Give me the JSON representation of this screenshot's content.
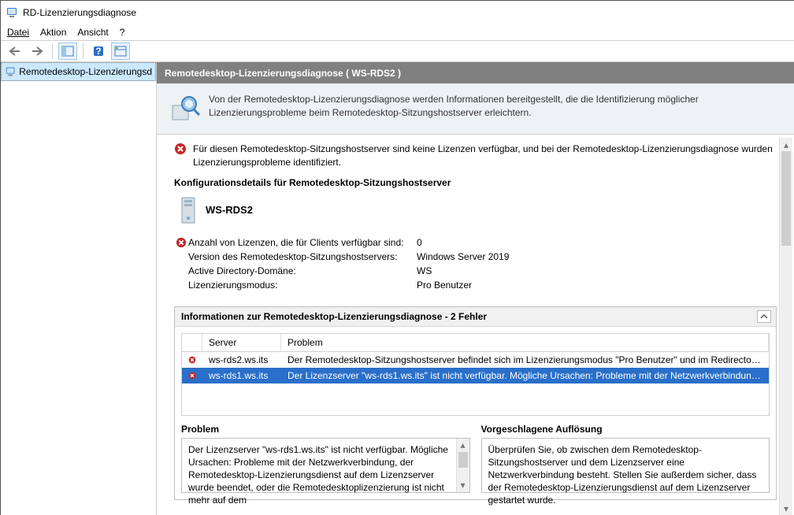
{
  "window": {
    "title": "RD-Lizenzierungsdiagnose"
  },
  "menu": {
    "file": "Datei",
    "action": "Aktion",
    "view": "Ansicht",
    "help": "?"
  },
  "tree": {
    "item0": "Remotedesktop-Lizenzierungsd"
  },
  "header": {
    "title": "Remotedesktop-Lizenzierungsdiagnose ( WS-RDS2 )"
  },
  "banner": {
    "text": "Von der Remotedesktop-Lizenzierungsdiagnose werden Informationen bereitgestellt, die die Identifizierung möglicher Lizenzierungsprobleme beim Remotedesktop-Sitzungshostserver erleichtern."
  },
  "alert": {
    "text": "Für diesen Remotedesktop-Sitzungshostserver sind keine Lizenzen verfügbar, und bei der Remotedesktop-Lizenzierungsdiagnose wurden Lizenzierungsprobleme identifiziert."
  },
  "config": {
    "section_title": "Konfigurationsdetails für Remotedesktop-Sitzungshostserver",
    "server_name": "WS-RDS2",
    "rows": {
      "licenses_label": "Anzahl von Lizenzen, die für Clients verfügbar sind:",
      "licenses_value": "0",
      "version_label": "Version des Remotedesktop-Sitzungshostservers:",
      "version_value": "Windows Server 2019",
      "domain_label": "Active Directory-Domäne:",
      "domain_value": "WS",
      "mode_label": "Lizenzierungsmodus:",
      "mode_value": "Pro Benutzer"
    }
  },
  "diag": {
    "panel_title": "Informationen zur Remotedesktop-Lizenzierungsdiagnose - 2 Fehler",
    "col_server": "Server",
    "col_problem": "Problem",
    "rows": [
      {
        "server": "ws-rds2.ws.its",
        "problem": "Der Remotedesktop-Sitzungshostserver befindet sich im Lizenzierungsmodus \"Pro Benutzer\" und im Redirector-Modus \"Ne..."
      },
      {
        "server": "ws-rds1.ws.its",
        "problem": "Der Lizenzserver \"ws-rds1.ws.its\" ist nicht verfügbar. Mögliche Ursachen: Probleme mit der Netzwerkverbindung, der Remo..."
      }
    ]
  },
  "detail": {
    "problem_title": "Problem",
    "problem_text": "Der Lizenzserver \"ws-rds1.ws.its\" ist nicht verfügbar. Mögliche Ursachen: Probleme mit der Netzwerkverbindung, der Remotedesktop-Lizenzierungsdienst auf dem Lizenzserver wurde beendet, oder die Remotedesktoplizenzierung ist nicht mehr auf dem",
    "resolution_title": "Vorgeschlagene Auflösung",
    "resolution_text": "Überprüfen Sie, ob zwischen dem Remotedesktop-Sitzungshostserver und dem Lizenzserver eine Netzwerkverbindung besteht. Stellen Sie außerdem sicher, dass der Remotedesktop-Lizenzierungsdienst auf dem Lizenzserver gestartet wurde."
  }
}
